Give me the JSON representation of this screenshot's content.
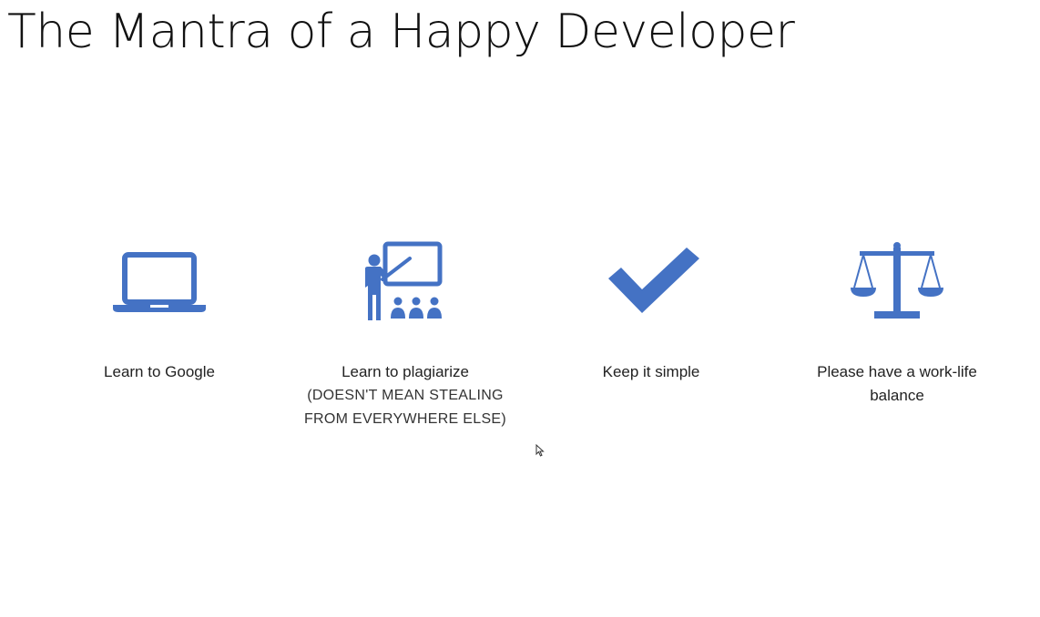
{
  "slide": {
    "title": "The Mantra of a Happy Developer"
  },
  "items": [
    {
      "icon": "laptop-icon",
      "caption": "Learn to Google"
    },
    {
      "icon": "teacher-presentation-icon",
      "caption": "Learn to plagiarize",
      "subcaption_1": "(DOESN'T MEAN STEALING",
      "subcaption_2": "FROM EVERYWHERE ELSE)"
    },
    {
      "icon": "checkmark-icon",
      "caption": "Keep it simple"
    },
    {
      "icon": "balance-scale-icon",
      "caption_1": "Please have a work-life",
      "caption_2": "balance"
    }
  ],
  "colors": {
    "icon": "#4472C4",
    "text": "#222222",
    "background": "#ffffff"
  }
}
